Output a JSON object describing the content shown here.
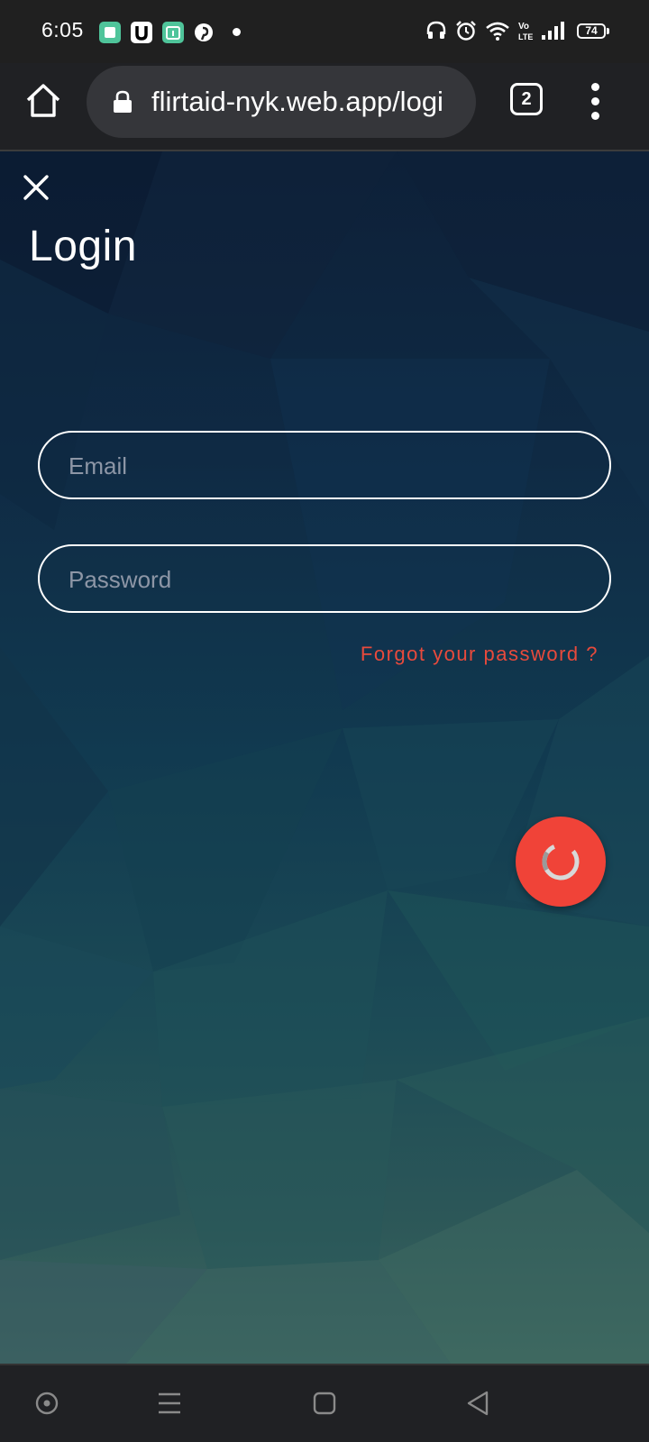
{
  "status_bar": {
    "time": "6:05",
    "battery": "74",
    "app_icons": [
      "window-app-icon",
      "u-app-icon",
      "calendar-app-icon",
      "pinterest-icon"
    ],
    "right_icons": [
      "headphones-icon",
      "alarm-icon",
      "wifi-icon",
      "volte-icon",
      "signal-icon",
      "battery-icon"
    ]
  },
  "browser": {
    "url": "flirtaid-nyk.web.app/logi",
    "tab_count": "2"
  },
  "page": {
    "title": "Login",
    "email_placeholder": "Email",
    "password_placeholder": "Password",
    "forgot_link": "Forgot your password ?",
    "accent_color": "#f04338"
  },
  "nav_bar": {
    "icons": [
      "recent-apps-icon",
      "menu-icon",
      "home-square-icon",
      "back-icon"
    ]
  }
}
